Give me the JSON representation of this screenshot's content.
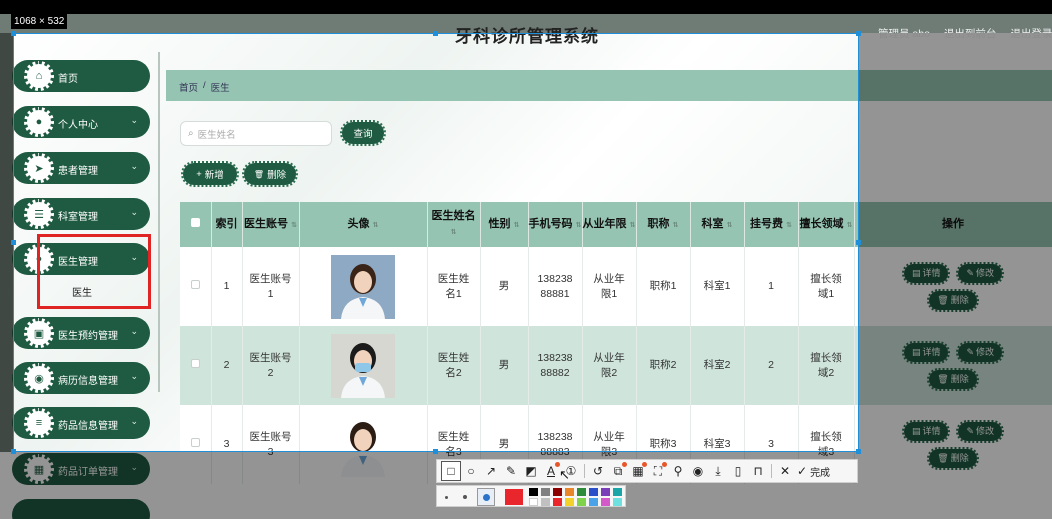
{
  "screenshot": {
    "size_label": "1068 × 532"
  },
  "header": {
    "title": "牙科诊所管理系统",
    "admin": "管理员 abo",
    "back_to_front": "退出到前台",
    "logout": "退出登录"
  },
  "breadcrumb": {
    "home": "首页",
    "sep": "/",
    "current": "医生"
  },
  "sidebar": {
    "items": [
      {
        "label": "首页",
        "icon": "home-icon",
        "glyph": "⌂",
        "chevron": ""
      },
      {
        "label": "个人中心",
        "icon": "user-icon",
        "glyph": "●",
        "chevron": "⌄"
      },
      {
        "label": "患者管理",
        "icon": "send-icon",
        "glyph": "➤",
        "chevron": "⌄"
      },
      {
        "label": "科室管理",
        "icon": "sliders-icon",
        "glyph": "☰",
        "chevron": "⌄"
      },
      {
        "label": "医生管理",
        "icon": "doctor-icon",
        "glyph": "●",
        "chevron": "⌄"
      },
      {
        "label": "医生预约管理",
        "icon": "clipboard-icon",
        "glyph": "▣",
        "chevron": "⌄"
      },
      {
        "label": "病历信息管理",
        "icon": "pin-icon",
        "glyph": "◉",
        "chevron": "⌄"
      },
      {
        "label": "药品信息管理",
        "icon": "list-icon",
        "glyph": "≡",
        "chevron": "⌄"
      },
      {
        "label": "药品订单管理",
        "icon": "grid-icon",
        "glyph": "▦",
        "chevron": "⌄"
      }
    ],
    "submenu_label": "医生"
  },
  "search": {
    "placeholder": "医生姓名",
    "button": "查询"
  },
  "actions": {
    "add": "新增",
    "delete": "删除",
    "add_icon": "+",
    "delete_icon": "🗑"
  },
  "table": {
    "headers": [
      "索引",
      "医生账号",
      "头像",
      "医生姓名",
      "性别",
      "手机号码",
      "从业年限",
      "职称",
      "科室",
      "挂号费",
      "擅长领域",
      "操作"
    ],
    "rows": [
      {
        "index": "1",
        "account": "医生账号1",
        "name": "医生姓名1",
        "gender": "男",
        "phone": "13823888881",
        "years": "从业年限1",
        "title": "职称1",
        "dept": "科室1",
        "fee": "1",
        "field": "擅长领域1"
      },
      {
        "index": "2",
        "account": "医生账号2",
        "name": "医生姓名2",
        "gender": "男",
        "phone": "13823888882",
        "years": "从业年限2",
        "title": "职称2",
        "dept": "科室2",
        "fee": "2",
        "field": "擅长领域2"
      },
      {
        "index": "3",
        "account": "医生账号3",
        "name": "医生姓名3",
        "gender": "男",
        "phone": "13823888883",
        "years": "从业年限3",
        "title": "职称3",
        "dept": "科室3",
        "fee": "3",
        "field": "擅长领域3"
      }
    ],
    "row_actions": {
      "detail": "详情",
      "edit": "修改",
      "delete": "删除"
    }
  },
  "snip_toolbar": {
    "done": "完成",
    "tools": [
      "rectangle-icon",
      "ellipse-icon",
      "arrow-icon",
      "pen-icon",
      "mosaic-icon",
      "text-icon",
      "number-icon",
      "undo-icon",
      "screenshot-ocr-icon",
      "translate-icon",
      "scan-icon",
      "pin-icon",
      "record-icon",
      "download-icon",
      "save-icon",
      "bookmark-icon",
      "close-icon",
      "check-icon"
    ]
  },
  "colors": {
    "primary": "#1f5b42",
    "accent_light": "#96c4b2",
    "row_alt": "#cfe4db",
    "highlight_box": "#e02323",
    "selection_border": "#1e8fd8",
    "current_pen": "#e8262b"
  }
}
